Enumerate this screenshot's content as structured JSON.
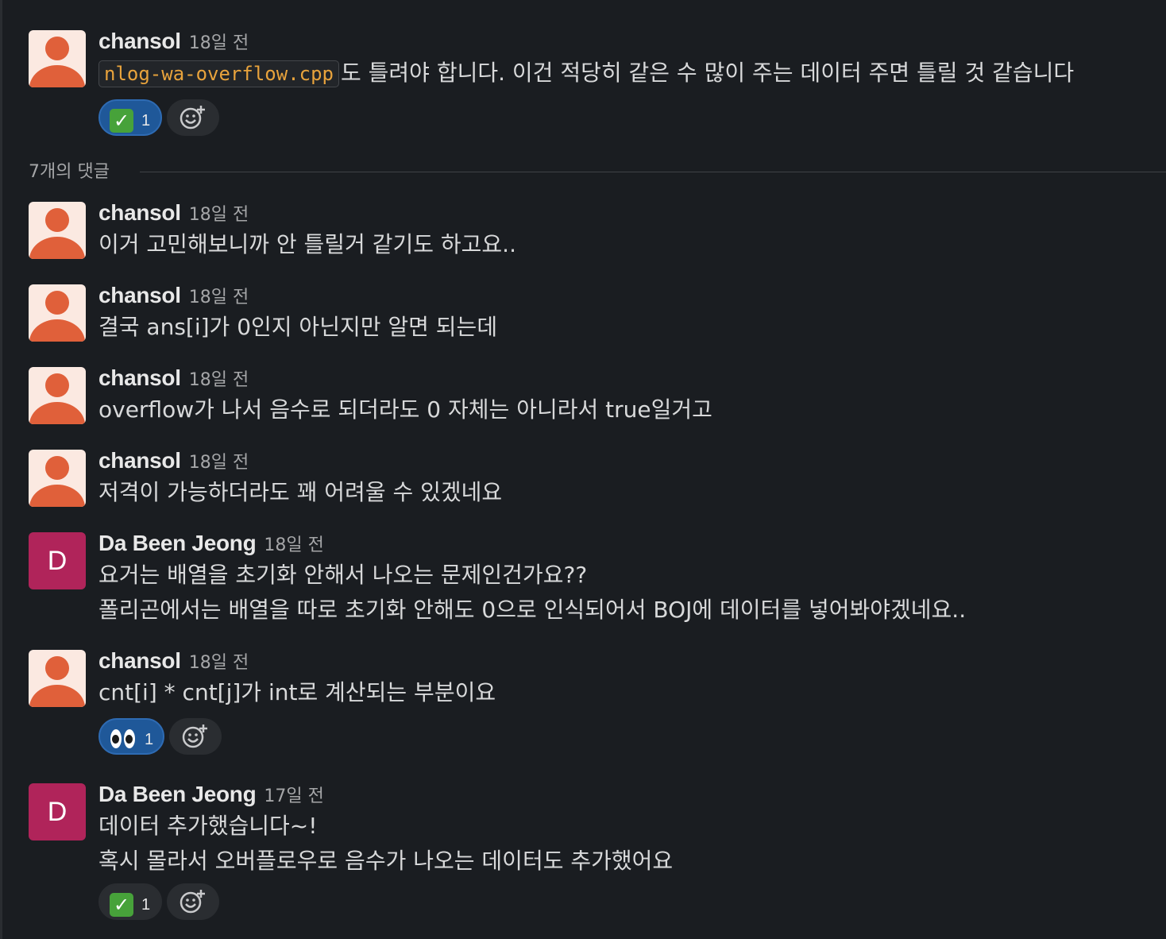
{
  "thread": {
    "top_message": {
      "author": "chansol",
      "time": "18일 전",
      "code": "nlog-wa-overflow.cpp",
      "text": "도 틀려야 합니다. 이건 적당히 같은 수 많이 주는 데이터 주면 틀릴 것 같습니다",
      "reaction": {
        "emoji": "white-check-mark",
        "count": "1"
      }
    },
    "replies_label": "7개의 댓글",
    "replies": [
      {
        "author": "chansol",
        "time": "18일 전",
        "lines": [
          "이거 고민해보니까 안 틀릴거 같기도 하고요.."
        ]
      },
      {
        "author": "chansol",
        "time": "18일 전",
        "lines": [
          "결국 ans[i]가 0인지 아닌지만 알면 되는데"
        ]
      },
      {
        "author": "chansol",
        "time": "18일 전",
        "lines": [
          "overflow가 나서 음수로 되더라도 0 자체는 아니라서 true일거고"
        ]
      },
      {
        "author": "chansol",
        "time": "18일 전",
        "lines": [
          "저격이 가능하더라도 꽤 어려울 수 있겠네요"
        ]
      },
      {
        "author": "Da Been Jeong",
        "avatar_letter": "D",
        "time": "18일 전",
        "lines": [
          "요거는 배열을 초기화 안해서 나오는 문제인건가요??",
          "폴리곤에서는 배열을 따로 초기화 안해도 0으로 인식되어서 BOJ에 데이터를 넣어봐야겠네요.."
        ]
      },
      {
        "author": "chansol",
        "time": "18일 전",
        "lines": [
          "cnt[i] * cnt[j]가 int로 계산되는 부분이요"
        ],
        "reaction": {
          "emoji": "eyes",
          "count": "1"
        }
      },
      {
        "author": "Da Been Jeong",
        "avatar_letter": "D",
        "time": "17일 전",
        "lines": [
          "데이터 추가했습니다~!",
          "혹시 몰라서 오버플로우로 음수가 나오는 데이터도 추가했어요"
        ],
        "reaction": {
          "emoji": "white-check-mark",
          "count": "1"
        }
      }
    ]
  },
  "colors": {
    "background": "#1a1d21",
    "avatar_person": "#e0603a",
    "avatar_letter_bg": "#b0245a",
    "code_text": "#e8a33c",
    "reaction_active": "#1f5899"
  }
}
